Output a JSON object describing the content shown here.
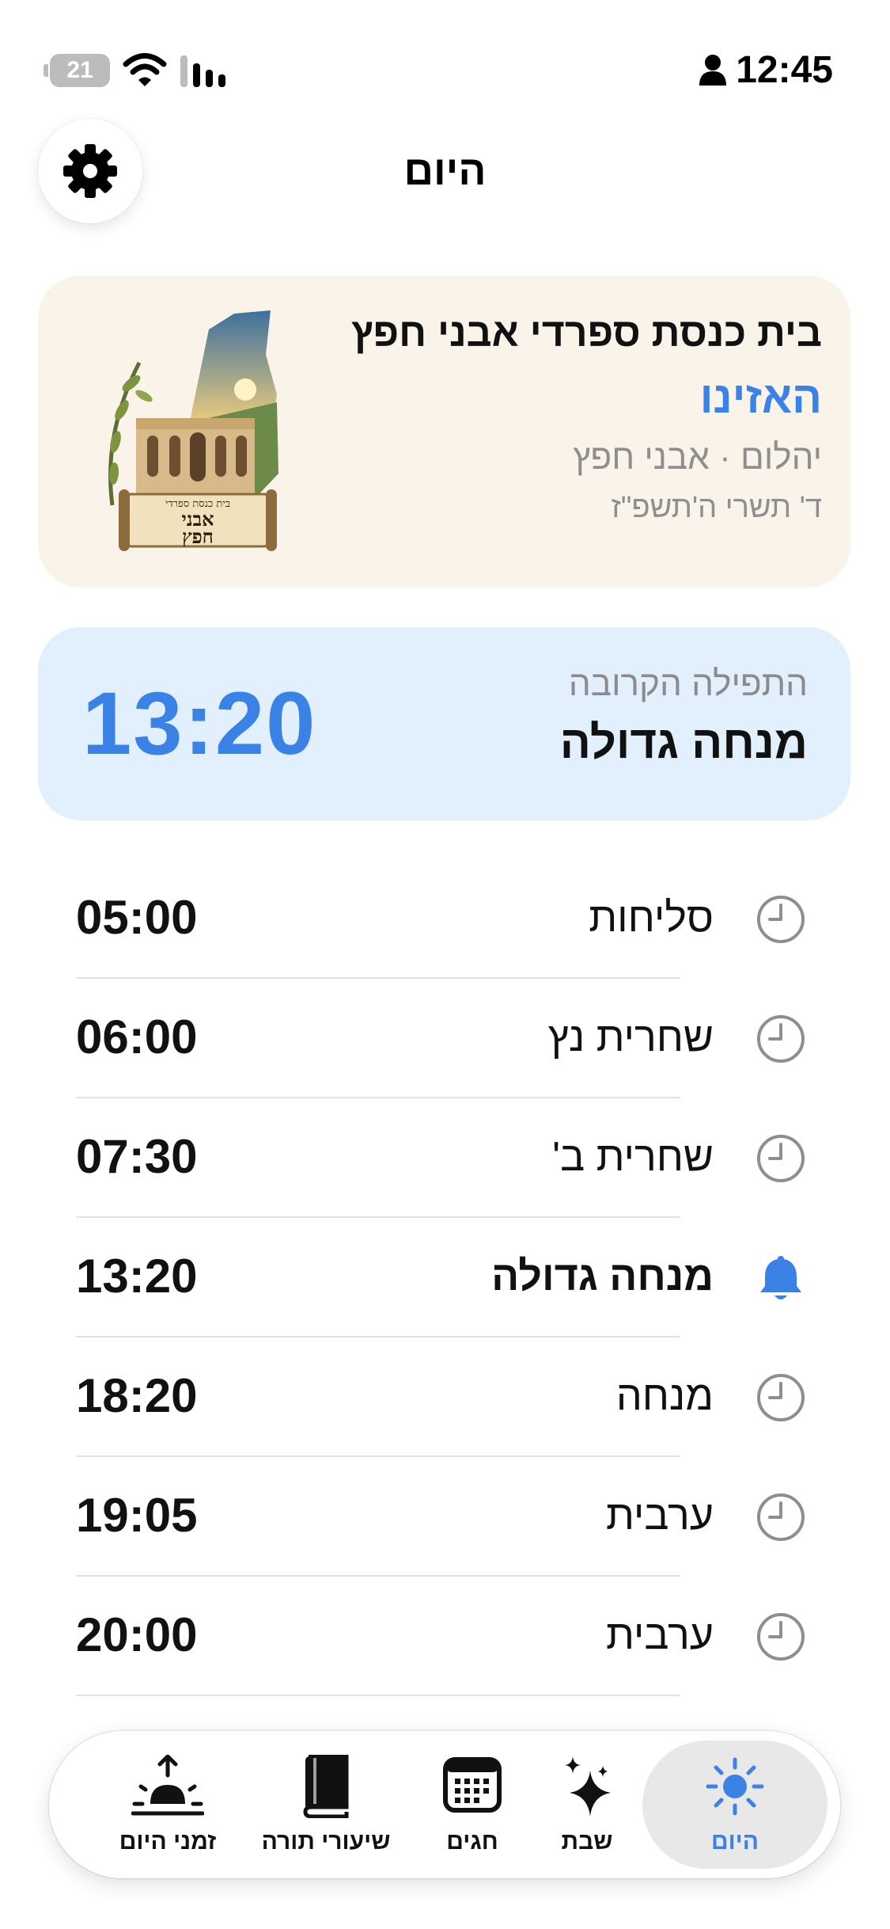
{
  "status_bar": {
    "battery_level": "21",
    "time": "12:45"
  },
  "header": {
    "title": "היום",
    "settings_icon": "gear-icon"
  },
  "synagogue": {
    "name": "בית כנסת ספרדי אבני חפץ",
    "section": "האזינו",
    "location": "יהלום · אבני חפץ",
    "hebrew_date": "ד' תשרי ה'תשפ\"ז",
    "logo_top_text": "בית כנסת ספרדי",
    "logo_name_line1": "אבני",
    "logo_name_line2": "חפץ"
  },
  "next_prayer": {
    "label": "התפילה הקרובה",
    "name": "מנחה גדולה",
    "time": "13:20",
    "accent_color": "#3b82e6"
  },
  "prayers": [
    {
      "name": "סליחות",
      "time": "05:00",
      "icon": "clock-icon",
      "highlight": false
    },
    {
      "name": "שחרית נץ",
      "time": "06:00",
      "icon": "clock-icon",
      "highlight": false
    },
    {
      "name": "שחרית ב'",
      "time": "07:30",
      "icon": "clock-icon",
      "highlight": false
    },
    {
      "name": "מנחה גדולה",
      "time": "13:20",
      "icon": "bell-icon",
      "highlight": true
    },
    {
      "name": "מנחה",
      "time": "18:20",
      "icon": "clock-icon",
      "highlight": false
    },
    {
      "name": "ערבית",
      "time": "19:05",
      "icon": "clock-icon",
      "highlight": false
    },
    {
      "name": "ערבית",
      "time": "20:00",
      "icon": "clock-icon",
      "highlight": false
    }
  ],
  "tab_bar": {
    "tabs": [
      {
        "label": "היום",
        "icon": "sun-icon",
        "active": true
      },
      {
        "label": "שבת",
        "icon": "sparkles-icon",
        "active": false
      },
      {
        "label": "חגים",
        "icon": "calendar-icon",
        "active": false
      },
      {
        "label": "שיעורי תורה",
        "icon": "book-icon",
        "active": false
      },
      {
        "label": "זמני היום",
        "icon": "sunrise-icon",
        "active": false
      }
    ]
  }
}
